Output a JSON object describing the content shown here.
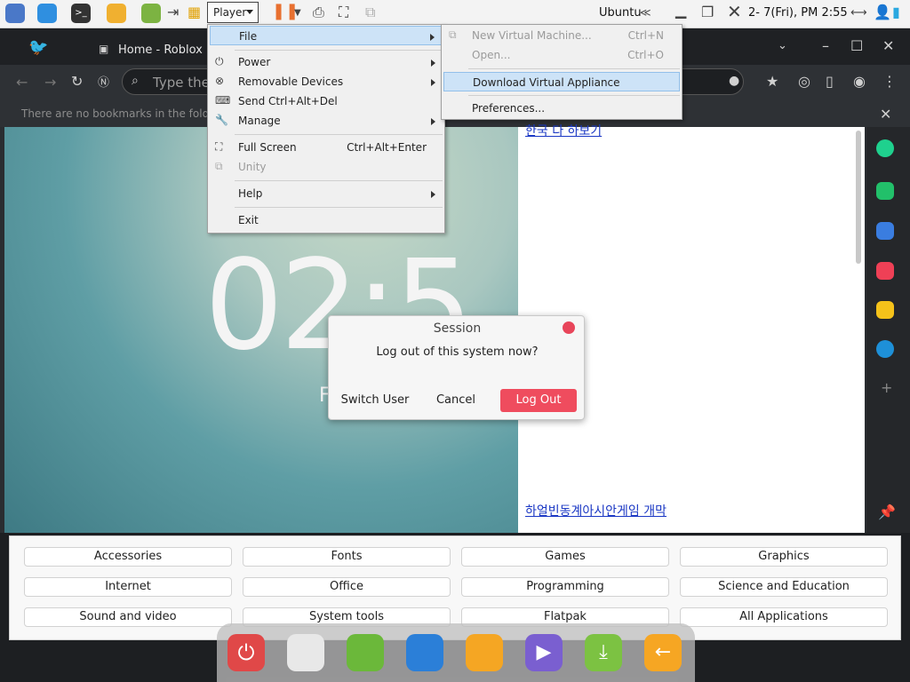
{
  "topbar": {
    "player_label": "Player",
    "host_name": "Ubuntu",
    "clock": "2- 7(Fri), PM 2:55",
    "icons": [
      "network-icon",
      "vmware-icon",
      "terminal-icon",
      "files-icon",
      "download-icon",
      "sendkey-icon",
      "pause-icon",
      "removable-icon",
      "fullscreen-icon",
      "unity-icon"
    ],
    "colors": {
      "accent": "#e8455a"
    }
  },
  "browser": {
    "tab_title": "Home - Roblox",
    "address_placeholder": "Type the",
    "bookmarks_hint": "There are no bookmarks in the folder s"
  },
  "page": {
    "clock_big": "02:5",
    "clock_sub": "F",
    "top_link": "한국 다 하보기",
    "bottom_link": "하얼빈동계아시안게임 개막"
  },
  "player_menu": {
    "file": "File",
    "power": "Power",
    "removable": "Removable Devices",
    "send_cad": "Send Ctrl+Alt+Del",
    "manage": "Manage",
    "full_screen": "Full Screen",
    "full_screen_shortcut": "Ctrl+Alt+Enter",
    "unity": "Unity",
    "help": "Help",
    "exit": "Exit"
  },
  "file_menu": {
    "new_vm": "New Virtual Machine...",
    "new_vm_shortcut": "Ctrl+N",
    "open": "Open...",
    "open_shortcut": "Ctrl+O",
    "download_appliance": "Download Virtual Appliance",
    "preferences": "Preferences..."
  },
  "session_dialog": {
    "title": "Session",
    "message": "Log out of this system now?",
    "switch_user": "Switch User",
    "cancel": "Cancel",
    "log_out": "Log Out"
  },
  "categories": [
    "Accessories",
    "Fonts",
    "Games",
    "Graphics",
    "Internet",
    "Office",
    "Programming",
    "Science and Education",
    "Sound and video",
    "System tools",
    "Flatpak",
    "All Applications"
  ],
  "dock": [
    "power-icon",
    "trash-icon",
    "app-store-icon",
    "browser-icon",
    "files-icon",
    "media-player-icon",
    "download-icon",
    "back-icon"
  ]
}
